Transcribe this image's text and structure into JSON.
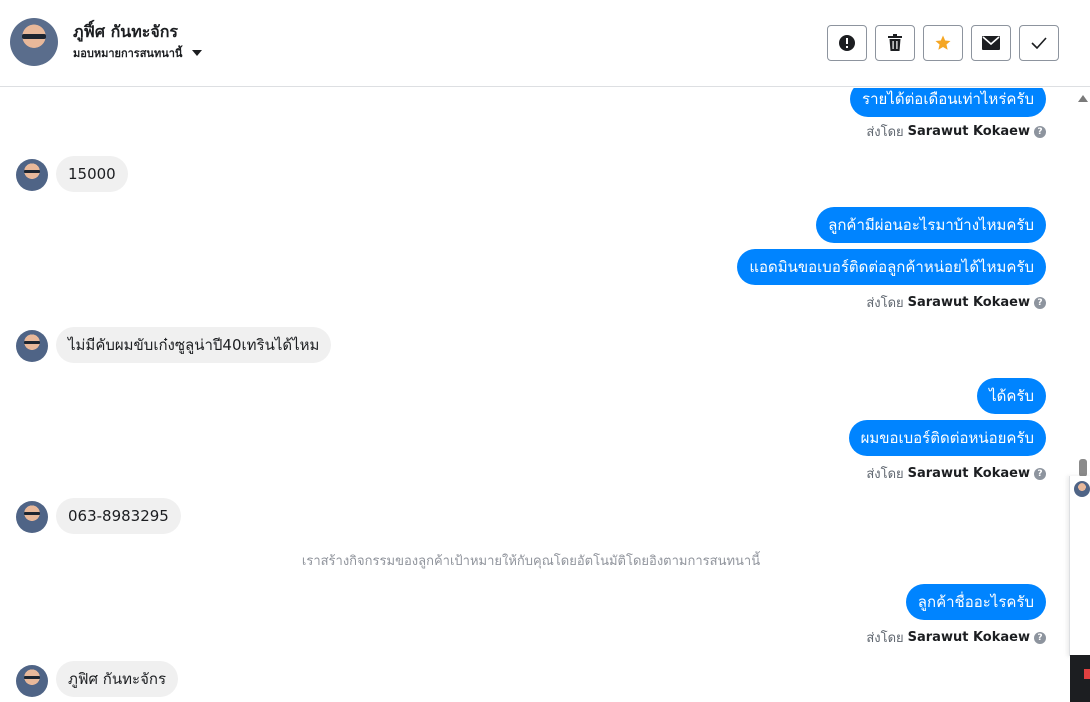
{
  "header": {
    "contact_name": "ภูฟิ์ศ กันทะจักร",
    "assign_label": "มอบหมายการสนทนานี้"
  },
  "toolbar": {
    "buttons": [
      {
        "name": "spam-button",
        "icon": "exclamation-circle-icon"
      },
      {
        "name": "delete-button",
        "icon": "trash-icon"
      },
      {
        "name": "star-button",
        "icon": "star-icon",
        "color": "#f5a623"
      },
      {
        "name": "mark-unread-button",
        "icon": "envelope-icon"
      },
      {
        "name": "mark-done-button",
        "icon": "check-icon"
      }
    ]
  },
  "messages": {
    "m1": "รายได้ต่อเดือนเท่าไหร่ครับ",
    "sent_by_1": "ส่งโดย",
    "agent_1": "Sarawut Kokaew",
    "in1": "15000",
    "m2": "ลูกค้ามีผ่อนอะไรมาบ้างไหมครับ",
    "m3": "แอดมินขอเบอร์ติดต่อลูกค้าหน่อยได้ไหมครับ",
    "sent_by_2": "ส่งโดย",
    "agent_2": "Sarawut Kokaew",
    "in2": "ไม่มีคับผมขับเก๋งซูลูน่าปี40เทรินได้ไหม",
    "m4": "ได้ครับ",
    "m5": "ผมขอเบอร์ติดต่อหน่อยครับ",
    "sent_by_3": "ส่งโดย",
    "agent_3": "Sarawut Kokaew",
    "in3": "063-8983295",
    "system_note": "เราสร้างกิจกรรมของลูกค้าเป้าหมายให้กับคุณโดยอัตโนมัติโดยอิงตามการสนทนานี้",
    "m6": "ลูกค้าชื่ออะไรครับ",
    "sent_by_4": "ส่งโดย",
    "agent_4": "Sarawut Kokaew",
    "in4": "ภูฟิศ  กันทะจักร"
  },
  "colors": {
    "outgoing_bubble": "#0084ff",
    "incoming_bubble": "#f0f0f0"
  }
}
